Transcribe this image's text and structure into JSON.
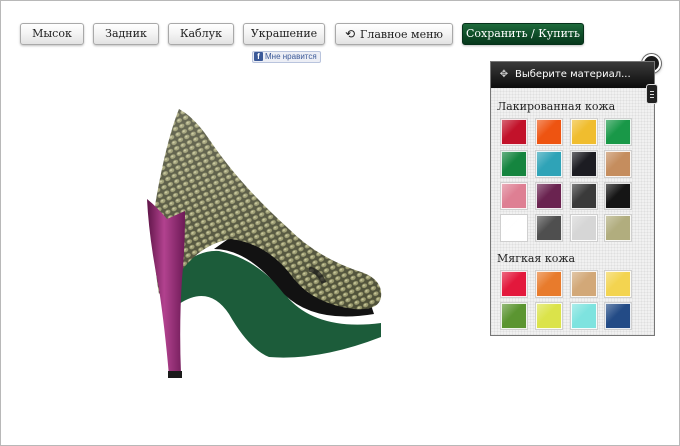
{
  "toolbar": {
    "buttons": [
      {
        "label": "Мысок"
      },
      {
        "label": "Задник"
      },
      {
        "label": "Каблук"
      },
      {
        "label": "Украшение"
      },
      {
        "label": "Главное меню"
      },
      {
        "label": "Сохранить / Купить"
      }
    ],
    "undo_icon": "undo-icon"
  },
  "facebook": {
    "like_label": "Мне нравится",
    "icon": "f"
  },
  "panel": {
    "title": "Выберите материал...",
    "move_icon": "move-icon",
    "close_icon": "close-icon",
    "sections": [
      {
        "title": "Лакированная кожа",
        "swatches": [
          "#c2122a",
          "#ee5411",
          "#f0bd2e",
          "#199848",
          "#15853f",
          "#2fa3b7",
          "#1c1c22",
          "#c58d5e",
          "#de7f93",
          "#6a2350",
          "#3a3a3a",
          "#151515",
          "#ffffff",
          "#4f4f4f",
          "#d6d6d6",
          "#b1ad7e"
        ]
      },
      {
        "title": "Мягкая кожа",
        "swatches": [
          "#e3183c",
          "#e87b2c",
          "#d2a878",
          "#f3d450",
          "#5b9531",
          "#dbe34a",
          "#7ee3df",
          "#234b86"
        ]
      }
    ]
  },
  "colors": {
    "accent_button": "#0e4c28",
    "upper": "#5f6147",
    "heel": "#8d2a6e",
    "sole": "#1c5c3a"
  }
}
